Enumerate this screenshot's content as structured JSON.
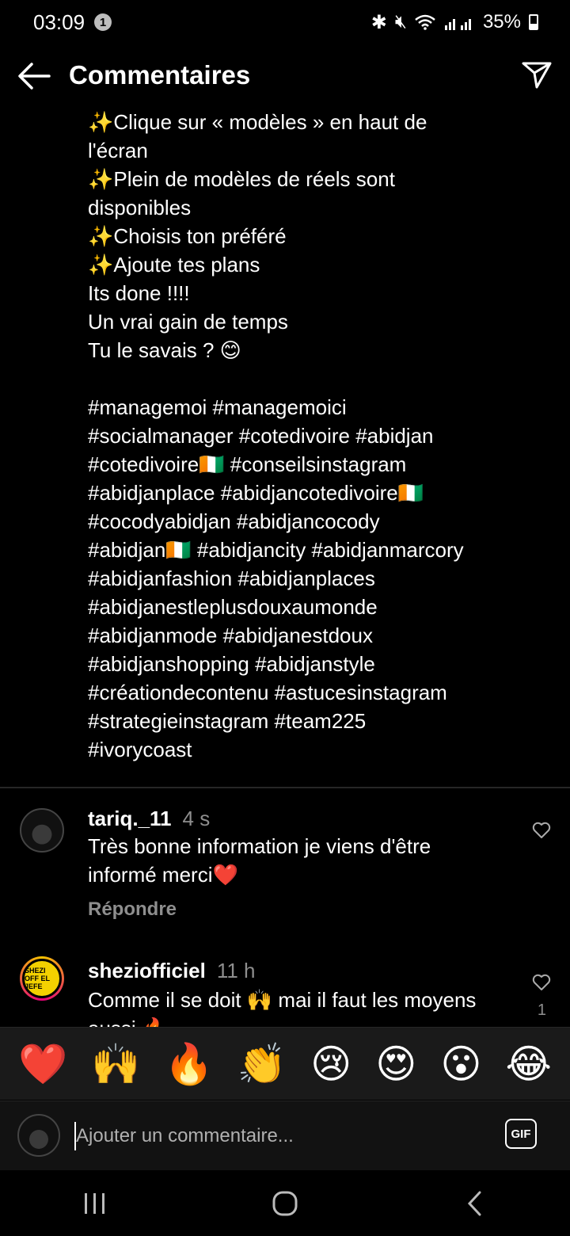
{
  "status": {
    "time": "03:09",
    "notification_count": "1",
    "battery": "35%"
  },
  "header": {
    "title": "Commentaires"
  },
  "caption": {
    "lines": [
      "✨Clique sur « modèles » en haut de",
      "l'écran",
      "✨Plein de modèles de réels sont",
      "disponibles",
      "✨Choisis ton préféré",
      "✨Ajoute tes plans",
      "Its done !!!!",
      "Un vrai gain de temps",
      "Tu le savais ? 😊",
      "",
      "#managemoi #managemoici",
      "#socialmanager #cotedivoire #abidjan",
      "#cotedivoire🇨🇮 #conseilsinstagram",
      "#abidjanplace #abidjancotedivoire🇨🇮",
      "#cocodyabidjan #abidjancocody",
      "#abidjan🇨🇮 #abidjancity #abidjanmarcory",
      "#abidjanfashion #abidjanplaces",
      "#abidjanestleplusdouxaumonde",
      "#abidjanmode #abidjanestdoux",
      "#abidjanshopping #abidjanstyle",
      "#créationdecontenu #astucesinstagram",
      "#strategieinstagram #team225",
      "#ivorycoast"
    ]
  },
  "comments": [
    {
      "user": "tariq._11",
      "time": "4 s",
      "text_line1": "Très bonne information je viens d'être",
      "text_line2": "informé merci❤️",
      "reply_label": "Répondre"
    },
    {
      "user": "sheziofficiel",
      "time": "11 h",
      "text_line1": "Comme il se doit 🙌 mai il faut les moyens",
      "text_line2": "aussi 🔥",
      "likes": "1",
      "avatar_text": "SHEZI OFF EL JEFE"
    }
  ],
  "emoji_bar": [
    "❤️",
    "🙌",
    "🔥",
    "👏",
    "😢",
    "😍",
    "😮",
    "😂"
  ],
  "input": {
    "placeholder": "Ajouter un commentaire...",
    "gif_label": "GIF"
  },
  "colors": {
    "background": "#000000",
    "secondary_text": "#8e8e8e",
    "bar": "#1a1a1a"
  }
}
